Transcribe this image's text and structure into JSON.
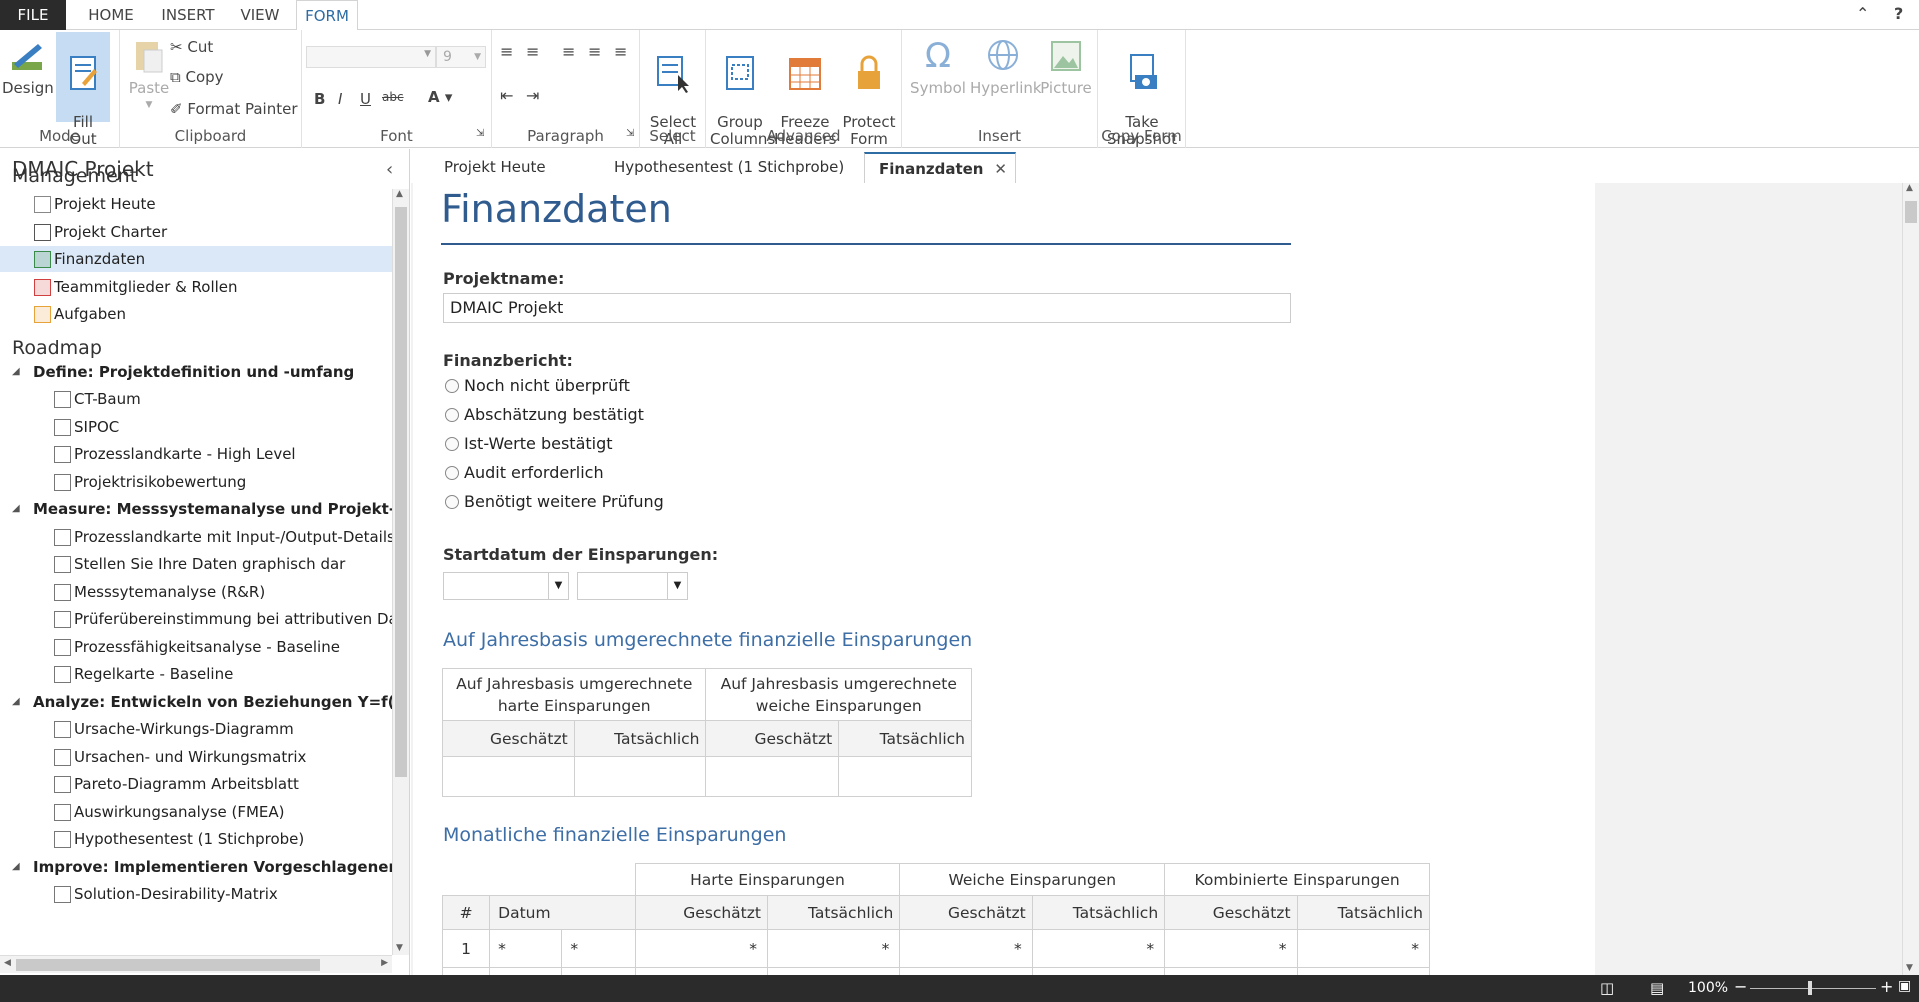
{
  "ribbon_tabs": {
    "file": "FILE",
    "home": "HOME",
    "insert": "INSERT",
    "view": "VIEW",
    "form": "FORM"
  },
  "ribbon": {
    "mode": {
      "label": "Mode",
      "design": "Design",
      "fill_out": "Fill\nOut"
    },
    "clipboard": {
      "label": "Clipboard",
      "paste": "Paste",
      "cut": "Cut",
      "copy": "Copy",
      "format_painter": "Format Painter"
    },
    "font": {
      "label": "Font",
      "size": "9"
    },
    "paragraph": {
      "label": "Paragraph"
    },
    "select": {
      "label": "Select",
      "select_all": "Select\nAll"
    },
    "advanced": {
      "label": "Advanced",
      "group_columns": "Group\nColumns",
      "freeze_headers": "Freeze\nHeaders",
      "protect_form": "Protect\nForm"
    },
    "insert": {
      "label": "Insert",
      "symbol": "Symbol",
      "hyperlink": "Hyperlink",
      "picture": "Picture"
    },
    "copy_form": {
      "label": "Copy Form",
      "take_snapshot": "Take\nSnapshot"
    }
  },
  "sidebar": {
    "title": "DMAIC Projekt",
    "management_title": "Management",
    "management": [
      {
        "label": "Projekt Heute",
        "icon": "house-icon"
      },
      {
        "label": "Projekt Charter",
        "icon": "charter-icon"
      },
      {
        "label": "Finanzdaten",
        "icon": "finance-icon",
        "selected": true
      },
      {
        "label": "Teammitglieder & Rollen",
        "icon": "team-icon"
      },
      {
        "label": "Aufgaben",
        "icon": "tasks-icon"
      }
    ],
    "roadmap_title": "Roadmap",
    "phases": [
      {
        "title": "Define:  Projektdefinition und -umfang",
        "items": [
          "CT-Baum",
          "SIPOC",
          "Prozesslandkarte - High Level",
          "Projektrisikobewertung"
        ]
      },
      {
        "title": "Measure:  Messsystemanalyse und Projekt-Baseline",
        "items": [
          "Prozesslandkarte mit Input-/Output-Details",
          "Stellen Sie Ihre Daten graphisch dar",
          "Messsytemanalyse (R&R)",
          "Prüferübereinstimmung bei attributiven Daten",
          "Prozessfähigkeitsanalyse - Baseline",
          "Regelkarte - Baseline"
        ]
      },
      {
        "title": "Analyze:  Entwickeln von Beziehungen Y=f(X)",
        "items": [
          "Ursache-Wirkungs-Diagramm",
          "Ursachen- und Wirkungsmatrix",
          "Pareto-Diagramm Arbeitsblatt",
          "Auswirkungsanalyse (FMEA)",
          "Hypothesentest (1 Stichprobe)"
        ]
      },
      {
        "title": "Improve:  Implementieren Vorgeschlagener Verbes",
        "items": [
          "Solution-Desirability-Matrix"
        ]
      }
    ]
  },
  "doc_tabs": [
    "Projekt Heute",
    "Hypothesentest (1 Stichprobe)",
    "Finanzdaten"
  ],
  "form": {
    "title": "Finanzdaten",
    "projektname_label": "Projektname:",
    "projektname_value": "DMAIC Projekt",
    "finanzbericht_label": "Finanzbericht:",
    "finanzbericht_options": [
      "Noch nicht überprüft",
      "Abschätzung bestätigt",
      "Ist-Werte bestätigt",
      "Audit erforderlich",
      "Benötigt weitere Prüfung"
    ],
    "startdatum_label": "Startdatum der Einsparungen:",
    "annual_title": "Auf Jahresbasis umgerechnete finanzielle Einsparungen",
    "annual_hard": "Auf Jahresbasis umgerechnete harte Einsparungen",
    "annual_soft": "Auf Jahresbasis umgerechnete weiche Einsparungen",
    "estimated": "Geschätzt",
    "actual": "Tatsächlich",
    "monthly_title": "Monatliche finanzielle Einsparungen",
    "monthly_hard": "Harte Einsparungen",
    "monthly_soft": "Weiche Einsparungen",
    "monthly_combined": "Kombinierte Einsparungen",
    "col_num": "#",
    "col_date": "Datum",
    "row1_num": "1",
    "star": "*"
  },
  "status": {
    "zoom": "100%"
  }
}
